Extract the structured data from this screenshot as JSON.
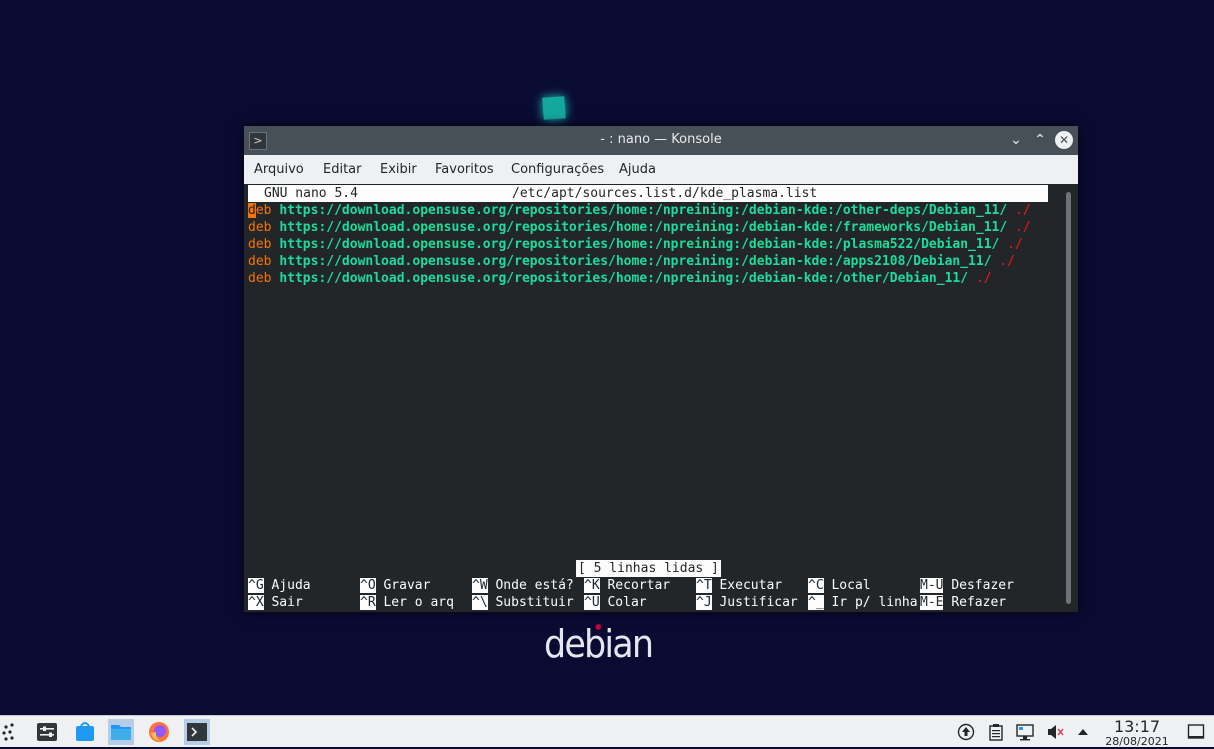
{
  "window": {
    "title": "- : nano — Konsole",
    "minimize_icon": "chevron-down-icon",
    "maximize_icon": "chevron-up-icon",
    "close_icon": "close-icon"
  },
  "menu": [
    "Arquivo",
    "Editar",
    "Exibir",
    "Favoritos",
    "Configurações",
    "Ajuda"
  ],
  "nano": {
    "version": "GNU nano 5.4",
    "filename": "/etc/apt/sources.list.d/kde_plasma.list",
    "lines": [
      {
        "type": "deb",
        "url": "https://download.opensuse.org/repositories/home:/npreining:/debian-kde:/other-deps/Debian_11/",
        "dist": "./"
      },
      {
        "type": "deb",
        "url": "https://download.opensuse.org/repositories/home:/npreining:/debian-kde:/frameworks/Debian_11/",
        "dist": "./"
      },
      {
        "type": "deb",
        "url": "https://download.opensuse.org/repositories/home:/npreining:/debian-kde:/plasma522/Debian_11/",
        "dist": "./"
      },
      {
        "type": "deb",
        "url": "https://download.opensuse.org/repositories/home:/npreining:/debian-kde:/apps2108/Debian_11/",
        "dist": "./"
      },
      {
        "type": "deb",
        "url": "https://download.opensuse.org/repositories/home:/npreining:/debian-kde:/other/Debian_11/",
        "dist": "./"
      }
    ],
    "status": "[ 5 linhas lidas ]",
    "shortcuts_row1": [
      {
        "key": "^G",
        "label": "Ajuda"
      },
      {
        "key": "^O",
        "label": "Gravar"
      },
      {
        "key": "^W",
        "label": "Onde está?"
      },
      {
        "key": "^K",
        "label": "Recortar"
      },
      {
        "key": "^T",
        "label": "Executar"
      },
      {
        "key": "^C",
        "label": "Local"
      },
      {
        "key": "M-U",
        "label": "Desfazer"
      }
    ],
    "shortcuts_row2": [
      {
        "key": "^X",
        "label": "Sair"
      },
      {
        "key": "^R",
        "label": "Ler o arq"
      },
      {
        "key": "^\\",
        "label": "Substituir"
      },
      {
        "key": "^U",
        "label": "Colar"
      },
      {
        "key": "^J",
        "label": "Justificar"
      },
      {
        "key": "^_",
        "label": "Ir p/ linha"
      },
      {
        "key": "M-E",
        "label": "Refazer"
      }
    ]
  },
  "desktop": {
    "logo_text": "debian"
  },
  "taskbar": {
    "items": [
      "application-launcher-icon",
      "system-settings-icon",
      "discover-icon",
      "file-manager-icon",
      "firefox-icon",
      "konsole-icon"
    ],
    "tray": [
      "updates-icon",
      "clipboard-icon",
      "network-icon",
      "volume-muted-icon",
      "tray-expand-icon"
    ],
    "time": "13:17",
    "date": "28/08/2021",
    "show_desktop_icon": "show-desktop-icon"
  }
}
